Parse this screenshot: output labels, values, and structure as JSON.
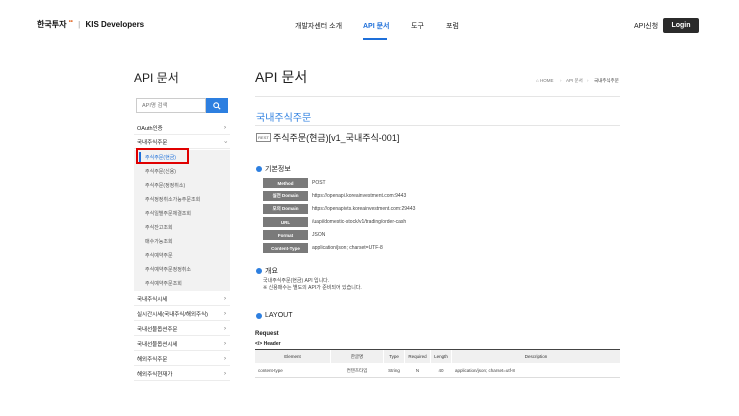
{
  "header": {
    "brand": "한국투자",
    "brand_dots": "••",
    "separator": "|",
    "product": "KIS Developers",
    "nav": [
      "개발자센터 소개",
      "API 문서",
      "도구",
      "포럼"
    ],
    "active_nav_index": 1,
    "api_apply": "API신청",
    "login": "Login"
  },
  "sidebar": {
    "title": "API 문서",
    "search_placeholder": "API명 검색",
    "items_top": [
      {
        "label": "OAuth인증",
        "chevron": "›"
      },
      {
        "label": "국내주식주문",
        "chevron": "›"
      }
    ],
    "sub_items": [
      "주식주문(현금)",
      "주식주문(신용)",
      "주식주문(정정취소)",
      "주식정정취소가능주문조회",
      "주식일별주문체결조회",
      "주식잔고조회",
      "매수가능조회",
      "주식예약주문",
      "주식예약주문정정취소",
      "주식예약주문조회"
    ],
    "active_sub_index": 0,
    "items_bottom": [
      {
        "label": "국내주식시세",
        "chevron": "›"
      },
      {
        "label": "실시간시세(국내주식/해외주식)",
        "chevron": "›"
      },
      {
        "label": "국내선물옵션주문",
        "chevron": "›"
      },
      {
        "label": "국내선물옵션시세",
        "chevron": "›"
      },
      {
        "label": "해외주식주문",
        "chevron": "›"
      },
      {
        "label": "해외주식현재가",
        "chevron": "›"
      }
    ]
  },
  "main": {
    "title": "API 문서",
    "breadcrumb": {
      "home": "HOME",
      "api": "API 문서",
      "current": "국내주식주문",
      "sep": "›"
    },
    "section": "국내주식주문",
    "rest_badge": "REST",
    "api_name": "주식주문(현금)[v1_국내주식-001]",
    "basic_info_title": "기본정보",
    "basic_info": [
      {
        "label": "Method",
        "value": "POST"
      },
      {
        "label": "실전 Domain",
        "value": "https://openapi.koreainvestment.com:9443"
      },
      {
        "label": "모의 Domain",
        "value": "https://openapivts.koreainvestment.com:29443"
      },
      {
        "label": "URL",
        "value": "/uapi/domestic-stock/v1/trading/order-cash"
      },
      {
        "label": "Format",
        "value": "JSON"
      },
      {
        "label": "Content-Type",
        "value": "application/json; charset=UTF-8"
      }
    ],
    "overview_title": "개요",
    "overview_lines": [
      "국내주식주문(현금) API 입니다.",
      "※ 신용매수는 별도의 API가 준비되어 있습니다."
    ],
    "layout_title": "LAYOUT",
    "request_label": "Request",
    "header_label": "</> Header",
    "table": {
      "columns": [
        "Element",
        "한글명",
        "Type",
        "Required",
        "Length",
        "Description"
      ],
      "rows": [
        [
          "content-type",
          "컨텐츠타입",
          "String",
          "N",
          "40",
          "application/json; charset=utf-8"
        ]
      ]
    }
  },
  "colors": {
    "accent": "#2d7fe0",
    "highlight": "#e00000",
    "login_bg": "#2b2b2b"
  }
}
